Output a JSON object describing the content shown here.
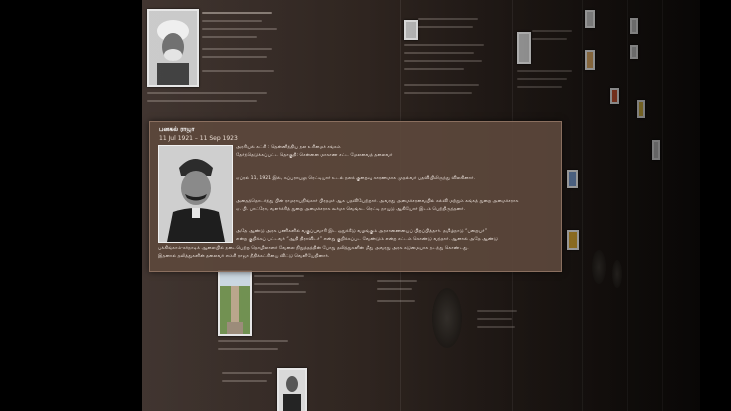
{
  "popup": {
    "title": "பனகல் ராஜா",
    "dates": "11 Jul 1921 – 11 Sep 1923",
    "meta_line1": "அரசியல் கட்சி : தென்னிந்திய நல உரிமைச் சங்கம்",
    "meta_line2": "தேர்ந்தெடுக்கப்பட்ட தொகுதி: சென்னை மாகாண சட்ட மேலவைத் தலைவர்",
    "para1": "ஏப்ரல் 11, 1921 இல், சுப்பராயலு ரெட்டியார் உடல் நலக் குறைவு காரணமாக முதல்வர் பதவியிலிருந்து விலகினார்.",
    "para2a": "அதைத்தொடர்ந்து பின் ராமராயநிங்கார் பிரதமர் ஆக பதவியேற்றார். அவரது அமைச்சரவையில் கல்வி மற்றும் சுங்கத் துறை அமைச்சராக",
    "para2b": "ஏ. பி. பாட்ரோ, வளர்ச்சித் துறை அமைச்சராக கூர்மா வெங்கட ரெட்டி நாயுடு ஆகியோர் இடம் பெற்றிருந்தனர்.",
    "para3a": "அதே ஆண்டு அரசு பணிகளில் வகுப்புவாரி இட ஒதுக்கீடு வழங்கும் அரசாணையைப் பிறப்பித்தார். தமிழ்நாடு “பறையர்”",
    "para3b": "என்ற குறிக்கப் பட்டவர் “ஆதி திராவிடர்” என்று குறிக்கப்பட வேண்டும் என்ற சட்டம் கொண்டு வந்தார். ஆனால் அதே ஆண்டு",
    "para3c": "பக்கிங்காம்-கர்நாடிக் ஆலையில் நடைபெற்ற தொழிலாளர் வேலை நிறுத்தத்தின் போது தலித்துகளின் மீது அவரது அரசு கடுமையாக நடந்து கொண்டது.",
    "para3d": "இதனால் தலித்துகளின் தலைவர் எம்சி ராஜா நீதிக்கட்சியை விட்டு வெளியேறினார்."
  },
  "background_items": [
    {
      "name": "portrait-turbaned-elder",
      "kind": "photo"
    },
    {
      "name": "portrait-dark-suit",
      "kind": "photo"
    },
    {
      "name": "statue-photo",
      "kind": "photo"
    },
    {
      "name": "state-emblem",
      "kind": "emblem"
    }
  ],
  "colors": {
    "wall": "#2f2520",
    "popup_bg": "#5c483c",
    "popup_text": "#f5ece6"
  }
}
